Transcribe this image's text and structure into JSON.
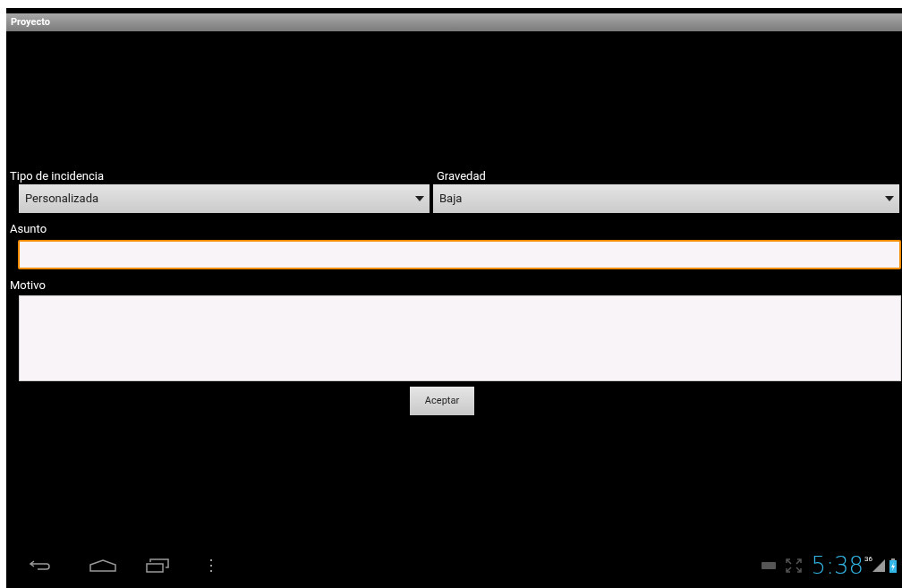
{
  "title_bar": {
    "title": "Proyecto"
  },
  "spinners": [
    {
      "label": "Tipo de incidencia",
      "value": "Personalizada"
    },
    {
      "label": "Gravedad",
      "value": "Baja"
    }
  ],
  "subject": {
    "label": "Asunto",
    "focused": true
  },
  "reason": {
    "label": "Motivo",
    "focused": false
  },
  "accept_button": "Aceptar",
  "status_bar": {
    "time": "5:38",
    "network": "36"
  }
}
